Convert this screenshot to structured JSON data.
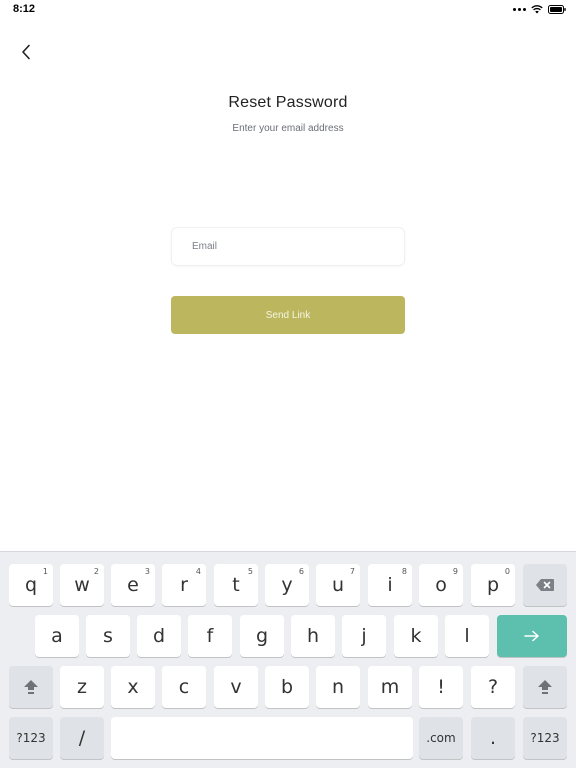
{
  "status_bar": {
    "time": "8:12"
  },
  "header": {
    "title": "Reset Password",
    "subtitle": "Enter your email address"
  },
  "form": {
    "email_placeholder": "Email",
    "email_value": "",
    "send_label": "Send Link"
  },
  "colors": {
    "accent_button": "#bcb75f",
    "keyboard_go": "#5dbfae"
  },
  "keyboard": {
    "row1": [
      {
        "label": "q",
        "hint": "1"
      },
      {
        "label": "w",
        "hint": "2"
      },
      {
        "label": "e",
        "hint": "3"
      },
      {
        "label": "r",
        "hint": "4"
      },
      {
        "label": "t",
        "hint": "5"
      },
      {
        "label": "y",
        "hint": "6"
      },
      {
        "label": "u",
        "hint": "7"
      },
      {
        "label": "i",
        "hint": "8"
      },
      {
        "label": "o",
        "hint": "9"
      },
      {
        "label": "p",
        "hint": "0"
      }
    ],
    "row2": [
      "a",
      "s",
      "d",
      "f",
      "g",
      "h",
      "j",
      "k",
      "l"
    ],
    "row3": [
      "z",
      "x",
      "c",
      "v",
      "b",
      "n",
      "m",
      "!",
      "?"
    ],
    "row4": {
      "numbers_left": "?123",
      "slash": "/",
      "dotcom": ".com",
      "dot": ".",
      "numbers_right": "?123"
    },
    "icons": {
      "backspace": "backspace-icon",
      "go": "arrow-right-icon",
      "shift": "shift-icon"
    }
  }
}
